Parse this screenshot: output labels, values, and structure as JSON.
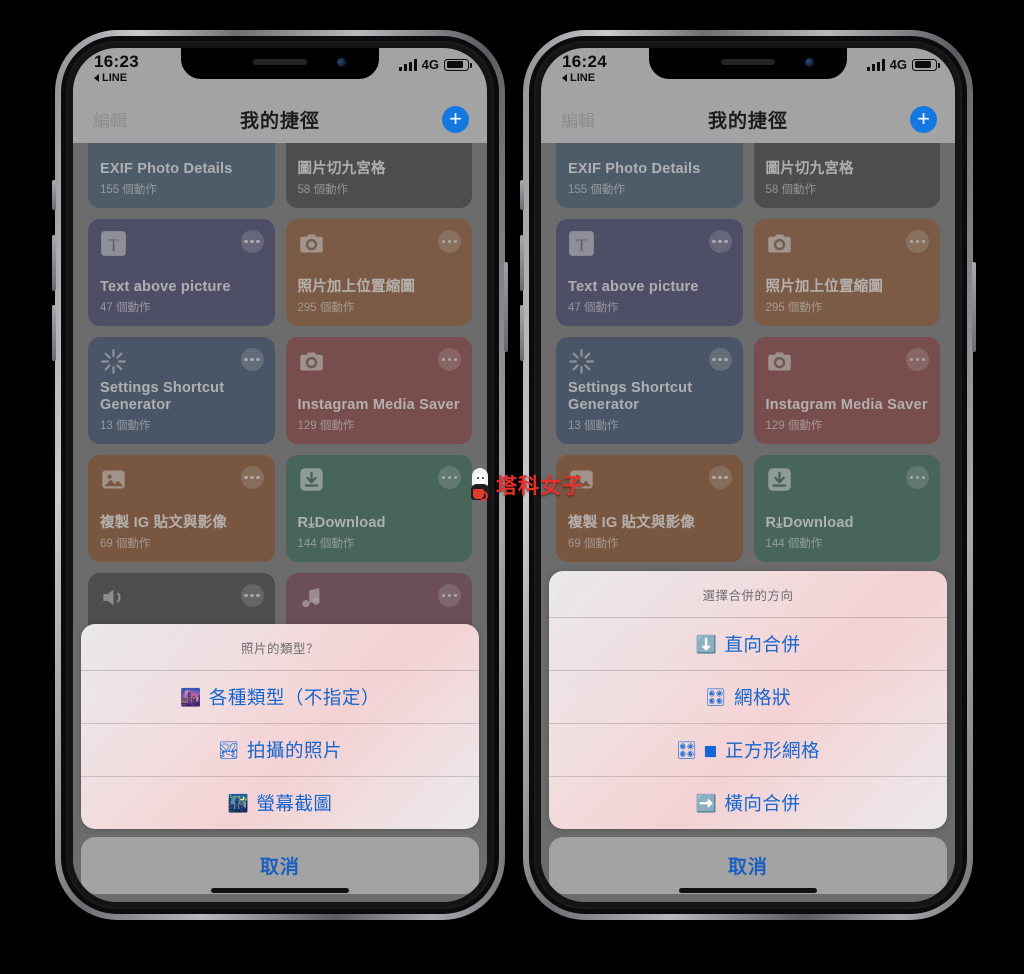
{
  "background_color": "#000000",
  "accent_blue": "#1666d0",
  "add_button_color": "#1478e0",
  "watermark": {
    "text": "塔科女子",
    "icon": "mascot-icon"
  },
  "phones": [
    {
      "id": "left",
      "status_bar": {
        "time": "16:23",
        "back_app": "LINE",
        "network": "4G",
        "signal_icon": "signal-bars-icon",
        "battery_icon": "battery-icon"
      },
      "nav": {
        "edit_label": "編輯",
        "title": "我的捷徑",
        "add_icon": "plus-icon"
      },
      "shortcuts": [
        {
          "title": "EXIF Photo Details",
          "subtitle": "155 個動作",
          "color": "#5f7285",
          "icon": ""
        },
        {
          "title": "圖片切九宮格",
          "subtitle": "58 個動作",
          "color": "#5d5d5d",
          "icon": ""
        },
        {
          "title": "Text above picture",
          "subtitle": "47 個動作",
          "color": "#5f6183",
          "icon": "text-icon"
        },
        {
          "title": "照片加上位置縮圖",
          "subtitle": "295 個動作",
          "color": "#a07152",
          "icon": "camera-icon"
        },
        {
          "title": "Settings Shortcut Generator",
          "subtitle": "13 個動作",
          "color": "#5a6b83",
          "icon": "sparkle-icon"
        },
        {
          "title": "Instagram Media Saver",
          "subtitle": "129 個動作",
          "color": "#9a5f5d",
          "icon": "camera-icon"
        },
        {
          "title": "複製 IG 貼文與影像",
          "subtitle": "69 個動作",
          "color": "#9c6b4a",
          "icon": "photo-icon"
        },
        {
          "title": "R⤓Download",
          "subtitle": "144 個動作",
          "color": "#55806d",
          "icon": "download-icon"
        },
        {
          "title": "",
          "subtitle": "",
          "color": "#5d5d5d",
          "icon": "speaker-icon"
        },
        {
          "title": "",
          "subtitle": "",
          "color": "#8a5f6b",
          "icon": "music-icon"
        }
      ],
      "action_sheet": {
        "title": "照片的類型？",
        "options": [
          {
            "emoji": "🌆",
            "label": "各種類型（不指定）"
          },
          {
            "emoji": "🏞",
            "label": "拍攝的照片"
          },
          {
            "emoji": "🌃",
            "label": "螢幕截圖"
          }
        ],
        "cancel_label": "取消"
      }
    },
    {
      "id": "right",
      "status_bar": {
        "time": "16:24",
        "back_app": "LINE",
        "network": "4G",
        "signal_icon": "signal-bars-icon",
        "battery_icon": "battery-icon"
      },
      "nav": {
        "edit_label": "編輯",
        "title": "我的捷徑",
        "add_icon": "plus-icon"
      },
      "shortcuts": [
        {
          "title": "EXIF Photo Details",
          "subtitle": "155 個動作",
          "color": "#5f7285",
          "icon": ""
        },
        {
          "title": "圖片切九宮格",
          "subtitle": "58 個動作",
          "color": "#5d5d5d",
          "icon": ""
        },
        {
          "title": "Text above picture",
          "subtitle": "47 個動作",
          "color": "#5f6183",
          "icon": "text-icon"
        },
        {
          "title": "照片加上位置縮圖",
          "subtitle": "295 個動作",
          "color": "#a07152",
          "icon": "camera-icon"
        },
        {
          "title": "Settings Shortcut Generator",
          "subtitle": "13 個動作",
          "color": "#5a6b83",
          "icon": "sparkle-icon"
        },
        {
          "title": "Instagram Media Saver",
          "subtitle": "129 個動作",
          "color": "#9a5f5d",
          "icon": "camera-icon"
        },
        {
          "title": "複製 IG 貼文與影像",
          "subtitle": "69 個動作",
          "color": "#9c6b4a",
          "icon": "photo-icon"
        },
        {
          "title": "R⤓Download",
          "subtitle": "144 個動作",
          "color": "#55806d",
          "icon": "download-icon"
        },
        {
          "title": "",
          "subtitle": "",
          "color": "#5d5d5d",
          "icon": "speaker-icon"
        },
        {
          "title": "",
          "subtitle": "",
          "color": "#8a5f6b",
          "icon": "music-icon"
        }
      ],
      "action_sheet": {
        "title": "選擇合併的方向",
        "options": [
          {
            "emoji": "⬇️",
            "label": "直向合併"
          },
          {
            "emoji": "🎛",
            "label": "網格狀"
          },
          {
            "emoji": "🎛 ◼",
            "label": "正方形網格"
          },
          {
            "emoji": "➡️",
            "label": "橫向合併"
          }
        ],
        "cancel_label": "取消"
      }
    }
  ]
}
